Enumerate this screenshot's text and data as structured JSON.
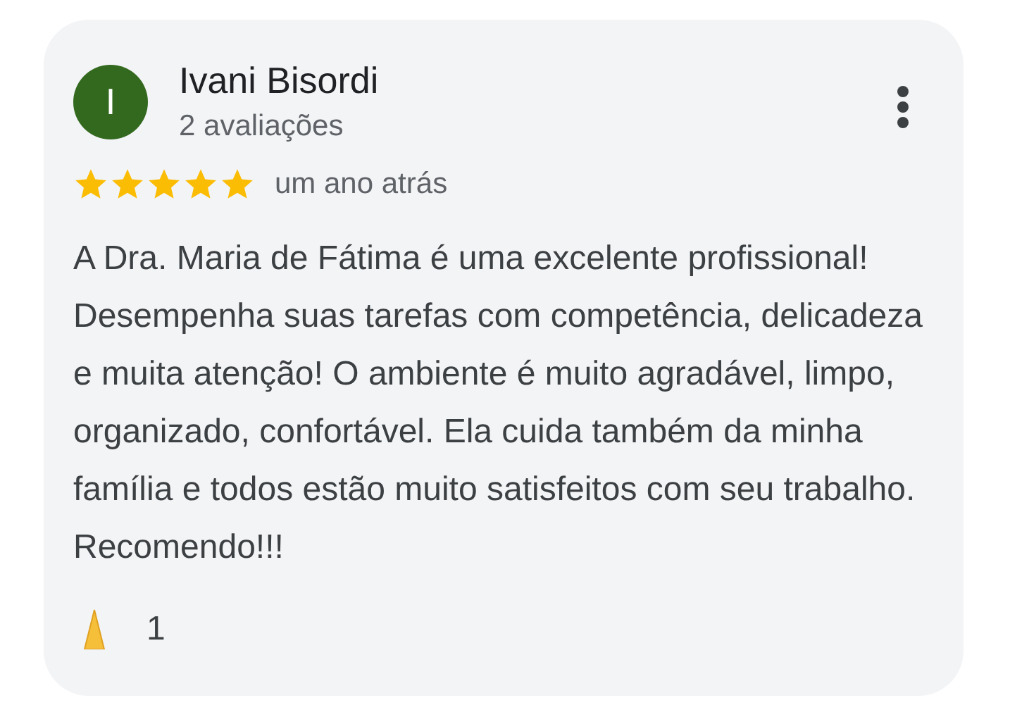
{
  "review": {
    "avatar_letter": "I",
    "author": "Ivani Bisordi",
    "review_count": "2 avaliações",
    "stars": 5,
    "time": "um ano atrás",
    "text": "A Dra. Maria de Fátima é uma excelente profissional! Desempenha suas tarefas com competência, delicadeza e muita atenção! O ambiente é muito agradável, limpo, organizado, confortável. Ela cuida também da minha família e todos estão muito satisfeitos com seu trabalho. Recomendo!!!",
    "likes": "1"
  }
}
